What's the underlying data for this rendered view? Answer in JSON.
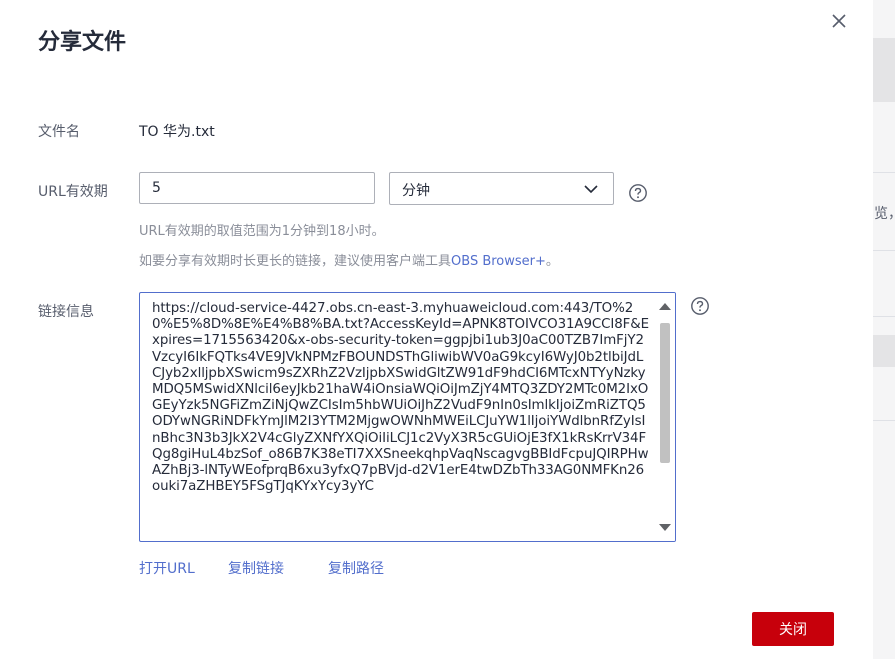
{
  "dialog": {
    "title": "分享文件",
    "close_icon": "close-icon",
    "file_name_label": "文件名",
    "file_name": "TO 华为.txt",
    "validity_label": "URL有效期",
    "validity_value": "5",
    "validity_unit": "分钟",
    "validity_hint": "URL有效期的取值范围为1分钟到18小时。",
    "browser_hint_prefix": "如要分享有效期时长更长的链接，建议使用客户端工具",
    "browser_hint_link": "OBS Browser+",
    "browser_hint_suffix": "。",
    "link_label": "链接信息",
    "link_value": "https://cloud-service-4427.obs.cn-east-3.myhuaweicloud.com:443/TO%20%E5%8D%8E%E4%B8%BA.txt?AccessKeyId=APNK8TOIVCO31A9CCI8F&Expires=1715563420&x-obs-security-token=ggpjbi1ub3J0aC00TZB7ImFjY2VzcyI6IkFQTks4VE9JVkNPMzFBOUNDSThGliwibWV0aG9kcyI6WyJ0b2tlbiJdLCJyb2xlljpbXSwicm9sZXRhZ2VzIjpbXSwidGltZW91dF9hdCI6MTcxNTYyNzkyMDQ5MSwidXNlcil6eyJkb21haW4iOnsiaWQiOiJmZjY4MTQ3ZDY2MTc0M2IxOGEyYzk5NGFiZmZiNjQwZCIsIm5hbWUiOiJhZ2VudF9nIn0sImlkIjoiZmRiZTQ5ODYwNGRiNDFkYmJlM2I3YTM2MjgwOWNhMWEiLCJuYW1lIjoiYWdlbnRfZyIsInBhc3N3b3JkX2V4cGlyZXNfYXQiOiIiLCJ1c2VyX3R5cGUiOjE3fX1kRsKrrV34FQg8giHuL4bzSof_o86B7K38eTI7XXSneekqhpVaqNscagvgBBIdFcpuJQIRPHwAZhBj3-lNTyWEofprqB6xu3yfxQ7pBVjd-d2V1erE4twDZbTh33AG0NMFKn26ouki7aZHBEY5FSgTJqKYxYcy3yYC",
    "help_icon": "help-icon",
    "actions": {
      "open_url": "打开URL",
      "copy_link": "复制链接",
      "copy_path": "复制路径"
    },
    "close_button": "关闭"
  },
  "backdrop": {
    "partial_text": "览，"
  },
  "colors": {
    "primary_red": "#c7000b",
    "link_blue": "#526ecc",
    "text": "#252b3a",
    "muted": "#8a8e99"
  }
}
